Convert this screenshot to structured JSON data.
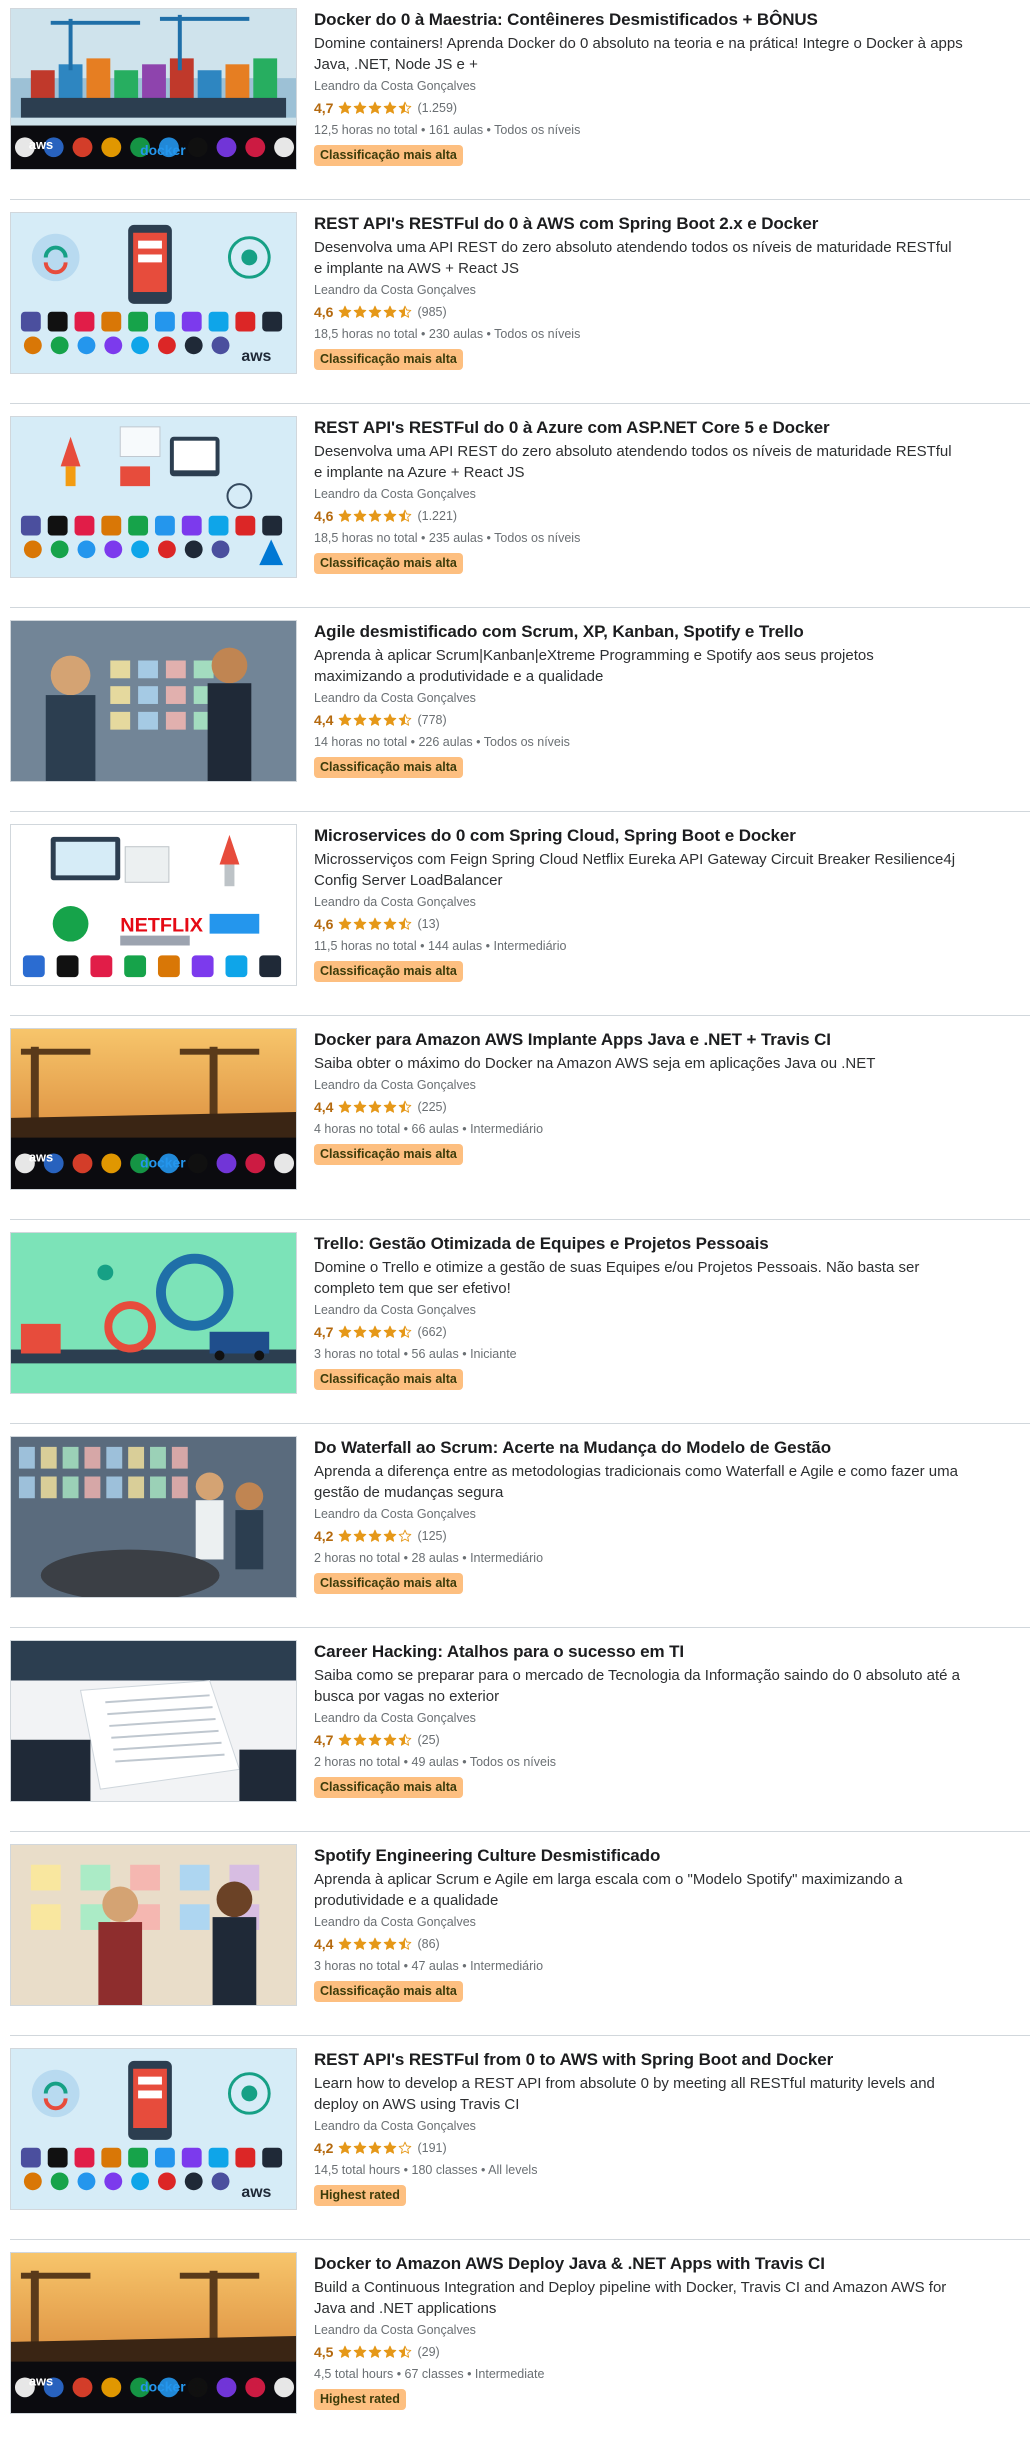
{
  "courses": [
    {
      "title": "Docker do 0 à Maestria: Contêineres Desmistificados + BÔNUS",
      "headline": "Domine containers! Aprenda Docker do 0 absoluto na teoria e na prática! Integre o Docker à apps Java, .NET, Node JS e +",
      "author": "Leandro da Costa Gonçalves",
      "rating": "4,7",
      "rating_value": 4.7,
      "reviews": "(1.259)",
      "meta": "12,5 horas no total • 161 aulas • Todos os níveis",
      "badge": "Classificação mais alta",
      "thumb": "port"
    },
    {
      "title": "REST API's RESTFul do 0 à AWS com Spring Boot 2.x e Docker",
      "headline": "Desenvolva uma API REST do zero absoluto atendendo todos os níveis de maturidade RESTful e implante na AWS + React JS",
      "author": "Leandro da Costa Gonçalves",
      "rating": "4,6",
      "rating_value": 4.6,
      "reviews": "(985)",
      "meta": "18,5 horas no total • 230 aulas • Todos os níveis",
      "badge": "Classificação mais alta",
      "thumb": "api-aws"
    },
    {
      "title": "REST API's RESTFul do 0 à Azure com ASP.NET Core 5 e Docker",
      "headline": "Desenvolva uma API REST do zero absoluto atendendo todos os níveis de maturidade RESTful e implante na Azure + React JS",
      "author": "Leandro da Costa Gonçalves",
      "rating": "4,6",
      "rating_value": 4.6,
      "reviews": "(1.221)",
      "meta": "18,5 horas no total • 235 aulas • Todos os níveis",
      "badge": "Classificação mais alta",
      "thumb": "api-azure"
    },
    {
      "title": "Agile desmistificado com Scrum, XP, Kanban, Spotify e Trello",
      "headline": "Aprenda à aplicar Scrum|Kanban|eXtreme Programming e Spotify aos seus projetos maximizando a produtividade e a qualidade",
      "author": "Leandro da Costa Gonçalves",
      "rating": "4,4",
      "rating_value": 4.4,
      "reviews": "(778)",
      "meta": "14 horas no total • 226 aulas • Todos os níveis",
      "badge": "Classificação mais alta",
      "thumb": "people"
    },
    {
      "title": "Microservices do 0 com Spring Cloud, Spring Boot e Docker",
      "headline": "Microsserviços com Feign Spring Cloud Netflix Eureka API Gateway Circuit Breaker Resilience4j Config Server LoadBalancer",
      "author": "Leandro da Costa Gonçalves",
      "rating": "4,6",
      "rating_value": 4.6,
      "reviews": "(13)",
      "meta": "11,5 horas no total • 144 aulas • Intermediário",
      "badge": "Classificação mais alta",
      "thumb": "microservices"
    },
    {
      "title": "Docker para Amazon AWS Implante Apps Java e .NET + Travis CI",
      "headline": "Saiba obter o máximo do Docker na Amazon AWS seja em aplicações Java ou .NET",
      "author": "Leandro da Costa Gonçalves",
      "rating": "4,4",
      "rating_value": 4.4,
      "reviews": "(225)",
      "meta": "4 horas no total • 66 aulas • Intermediário",
      "badge": "Classificação mais alta",
      "thumb": "port-sunset"
    },
    {
      "title": "Trello: Gestão Otimizada de Equipes e Projetos Pessoais",
      "headline": "Domine o Trello e otimize a gestão de suas Equipes e/ou Projetos Pessoais. Não basta ser completo tem que ser efetivo!",
      "author": "Leandro da Costa Gonçalves",
      "rating": "4,7",
      "rating_value": 4.7,
      "reviews": "(662)",
      "meta": "3 horas no total • 56 aulas • Iniciante",
      "badge": "Classificação mais alta",
      "thumb": "trello"
    },
    {
      "title": "Do Waterfall ao Scrum: Acerte na Mudança do Modelo de Gestão",
      "headline": "Aprenda a diferença entre as metodologias tradicionais como Waterfall e Agile e como fazer uma gestão de mudanças segura",
      "author": "Leandro da Costa Gonçalves",
      "rating": "4,2",
      "rating_value": 4.2,
      "reviews": "(125)",
      "meta": "2 horas no total • 28 aulas • Intermediário",
      "badge": "Classificação mais alta",
      "thumb": "meeting"
    },
    {
      "title": "Career Hacking: Atalhos para o sucesso em TI",
      "headline": "Saiba como se preparar para o mercado de Tecnologia da Informação saindo do 0 absoluto até a busca por vagas no exterior",
      "author": "Leandro da Costa Gonçalves",
      "rating": "4,7",
      "rating_value": 4.7,
      "reviews": "(25)",
      "meta": "2 horas no total • 49 aulas • Todos os níveis",
      "badge": "Classificação mais alta",
      "thumb": "paper"
    },
    {
      "title": "Spotify Engineering Culture Desmistificado",
      "headline": "Aprenda à aplicar Scrum e Agile em larga escala com o \"Modelo Spotify\" maximizando a produtividade e a qualidade",
      "author": "Leandro da Costa Gonçalves",
      "rating": "4,4",
      "rating_value": 4.4,
      "reviews": "(86)",
      "meta": "3 horas no total • 47 aulas • Intermediário",
      "badge": "Classificação mais alta",
      "thumb": "people2"
    },
    {
      "title": "REST API's RESTFul from 0 to AWS with Spring Boot and Docker",
      "headline": "Learn how to develop a REST API from absolute 0 by meeting all RESTful maturity levels and deploy on AWS using Travis CI",
      "author": "Leandro da Costa Gonçalves",
      "rating": "4,2",
      "rating_value": 4.2,
      "reviews": "(191)",
      "meta": "14,5 total hours • 180 classes • All levels",
      "badge": "Highest rated",
      "thumb": "api-aws"
    },
    {
      "title": "Docker to Amazon AWS Deploy Java & .NET Apps with Travis CI",
      "headline": "Build a Continuous Integration and Deploy pipeline with Docker, Travis CI and Amazon AWS for Java and .NET applications",
      "author": "Leandro da Costa Gonçalves",
      "rating": "4,5",
      "rating_value": 4.5,
      "reviews": "(29)",
      "meta": "4,5 total hours • 67 classes • Intermediate",
      "badge": "Highest rated",
      "thumb": "port-sunset"
    }
  ],
  "colors": {
    "star": "#e59819",
    "rating_text": "#b4690e",
    "badge_bg": "#fdbf80",
    "divider": "#d1d7dc"
  }
}
